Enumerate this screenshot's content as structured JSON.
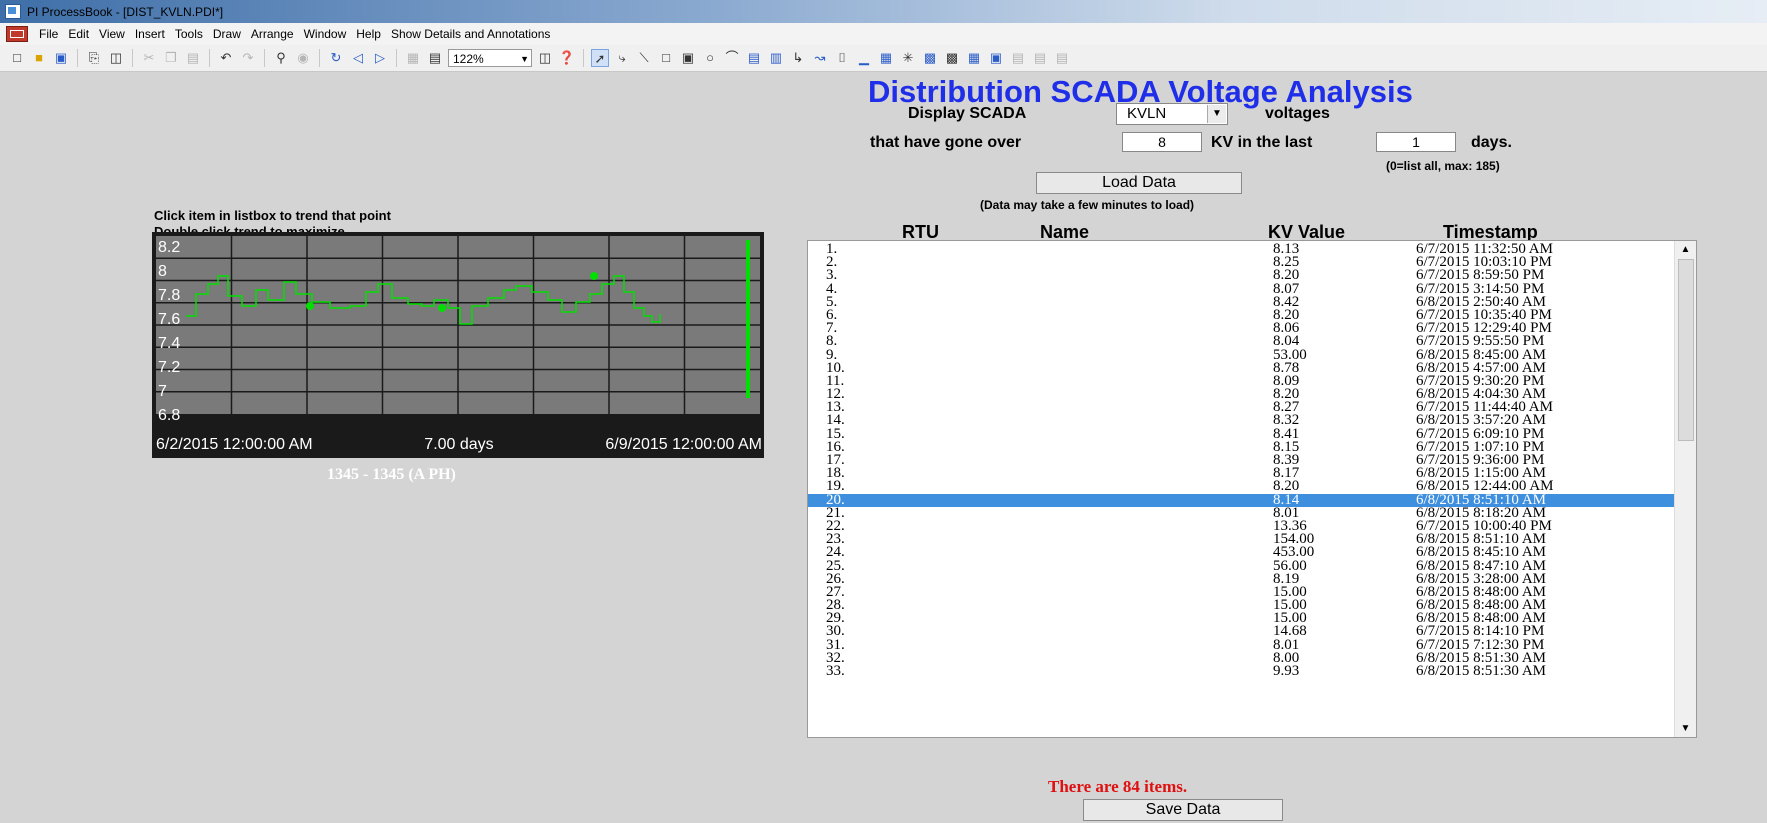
{
  "window": {
    "title": "PI ProcessBook - [DIST_KVLN.PDI*]"
  },
  "menu": [
    "File",
    "Edit",
    "View",
    "Insert",
    "Tools",
    "Draw",
    "Arrange",
    "Window",
    "Help",
    "Show Details and Annotations"
  ],
  "toolbar": {
    "zoom": "122%"
  },
  "header": {
    "title": "Distribution SCADA Voltage Analysis",
    "display_label": "Display SCADA",
    "scada_selected": "KVLN",
    "voltages_label": "voltages",
    "over_label": "that have gone over",
    "threshold_value": "8",
    "kv_label": "KV in the last",
    "days_value": "1",
    "days_label": "days.",
    "days_hint": "(0=list all, max: 185)",
    "load_button": "Load Data",
    "load_hint": "(Data may take a few minutes to load)"
  },
  "trend": {
    "hint1": "Click item in listbox to trend that point",
    "hint2": "Double click trend to maximize",
    "y_ticks": [
      "8.2",
      "8",
      "7.8",
      "7.6",
      "7.4",
      "7.2",
      "7",
      "6.8"
    ],
    "x_start": "6/2/2015 12:00:00 AM",
    "x_span": "7.00 days",
    "x_end": "6/9/2015 12:00:00 AM",
    "caption": "1345 - 1345 (A PH)",
    "line_color": "#00e000"
  },
  "table": {
    "headers": {
      "rtu": "RTU",
      "name": "Name",
      "kv": "KV Value",
      "ts": "Timestamp"
    },
    "selected_index": 19,
    "rows": [
      {
        "n": "1.",
        "v": "8.13",
        "t": "6/7/2015 11:32:50 AM"
      },
      {
        "n": "2.",
        "v": "8.25",
        "t": "6/7/2015 10:03:10 PM"
      },
      {
        "n": "3.",
        "v": "8.20",
        "t": "6/7/2015 8:59:50 PM"
      },
      {
        "n": "4.",
        "v": "8.07",
        "t": "6/7/2015 3:14:50 PM"
      },
      {
        "n": "5.",
        "v": "8.42",
        "t": "6/8/2015 2:50:40 AM"
      },
      {
        "n": "6.",
        "v": "8.20",
        "t": "6/7/2015 10:35:40 PM"
      },
      {
        "n": "7.",
        "v": "8.06",
        "t": "6/7/2015 12:29:40 PM"
      },
      {
        "n": "8.",
        "v": "8.04",
        "t": "6/7/2015 9:55:50 PM"
      },
      {
        "n": "9.",
        "v": "53.00",
        "t": "6/8/2015 8:45:00 AM"
      },
      {
        "n": "10.",
        "v": "8.78",
        "t": "6/8/2015 4:57:00 AM"
      },
      {
        "n": "11.",
        "v": "8.09",
        "t": "6/7/2015 9:30:20 PM"
      },
      {
        "n": "12.",
        "v": "8.20",
        "t": "6/8/2015 4:04:30 AM"
      },
      {
        "n": "13.",
        "v": "8.27",
        "t": "6/7/2015 11:44:40 AM"
      },
      {
        "n": "14.",
        "v": "8.32",
        "t": "6/8/2015 3:57:20 AM"
      },
      {
        "n": "15.",
        "v": "8.41",
        "t": "6/7/2015 6:09:10 PM"
      },
      {
        "n": "16.",
        "v": "8.15",
        "t": "6/7/2015 1:07:10 PM"
      },
      {
        "n": "17.",
        "v": "8.39",
        "t": "6/7/2015 9:36:00 PM"
      },
      {
        "n": "18.",
        "v": "8.17",
        "t": "6/8/2015 1:15:00 AM"
      },
      {
        "n": "19.",
        "v": "8.20",
        "t": "6/8/2015 12:44:00 AM"
      },
      {
        "n": "20.",
        "v": "8.14",
        "t": "6/8/2015 8:51:10 AM"
      },
      {
        "n": "21.",
        "v": "8.01",
        "t": "6/8/2015 8:18:20 AM"
      },
      {
        "n": "22.",
        "v": "13.36",
        "t": "6/7/2015 10:00:40 PM"
      },
      {
        "n": "23.",
        "v": "154.00",
        "t": "6/8/2015 8:51:10 AM"
      },
      {
        "n": "24.",
        "v": "453.00",
        "t": "6/8/2015 8:45:10 AM"
      },
      {
        "n": "25.",
        "v": "56.00",
        "t": "6/8/2015 8:47:10 AM"
      },
      {
        "n": "26.",
        "v": "8.19",
        "t": "6/8/2015 3:28:00 AM"
      },
      {
        "n": "27.",
        "v": "15.00",
        "t": "6/8/2015 8:48:00 AM"
      },
      {
        "n": "28.",
        "v": "15.00",
        "t": "6/8/2015 8:48:00 AM"
      },
      {
        "n": "29.",
        "v": "15.00",
        "t": "6/8/2015 8:48:00 AM"
      },
      {
        "n": "30.",
        "v": "14.68",
        "t": "6/7/2015 8:14:10 PM"
      },
      {
        "n": "31.",
        "v": "8.01",
        "t": "6/7/2015 7:12:30 PM"
      },
      {
        "n": "32.",
        "v": "8.00",
        "t": "6/8/2015 8:51:30 AM"
      },
      {
        "n": "33.",
        "v": "9.93",
        "t": "6/8/2015 8:51:30 AM"
      }
    ]
  },
  "footer": {
    "count": "There are 84 items.",
    "save_button": "Save Data"
  }
}
